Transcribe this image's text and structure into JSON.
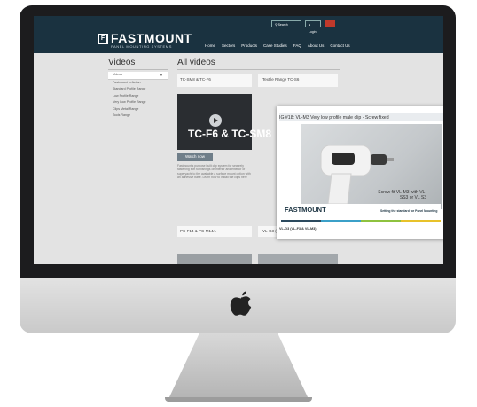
{
  "site": {
    "logo_text": "FASTMOUNT",
    "logo_sub": "PANEL MOUNTING SYSTEMS",
    "search_placeholder": "Search",
    "login": "Login",
    "nav": [
      "Home",
      "Sectors",
      "Products",
      "Case Studies",
      "FAQ",
      "About Us",
      "Contact Us"
    ]
  },
  "page": {
    "sidebar_title": "Videos",
    "main_title": "All videos",
    "sidebar_items": [
      "Videos",
      "Fastmount in Action",
      "Standard Profile Range",
      "Low Profile Range",
      "Very Low Profile Range",
      "Clips Metal Range",
      "Tools Range"
    ],
    "card1_title": "TC-SM8 & TC-F6",
    "card2_title": "Textile Range TC-S6",
    "thumb_text": "TC-F6 & TC-SM8",
    "watch_button": "Watch now",
    "description": "Fastmount's purpose built clip system for securely fastening soft furnishings on interior and exterior of superyacht to the available a surface mount option with an adhesive base. Learn how to install the clips here",
    "card3_title": "PC-F14 & PC-M14A",
    "card4_title": "VL-G3 (VL-F3 & VL-M3)"
  },
  "popup": {
    "title": "IG #18: VL-M3 Very low profile male clip - Screw fixed",
    "caption": "Screw fit VL-M3 with VL-SS3 or VL S3",
    "logo": "FASTMOUNT",
    "tagline": "Setting the standard for Panel Mounting",
    "bottom_label": "VL-G3 (VL-F3 & VL-M3)"
  },
  "colors": {
    "header": "#1a3240",
    "bezel": "#1c1c1e",
    "page_bg": "#e3e3e3",
    "button": "#6f7e89"
  },
  "icons": [
    "apple-logo-icon",
    "play-icon",
    "drill-icon"
  ]
}
